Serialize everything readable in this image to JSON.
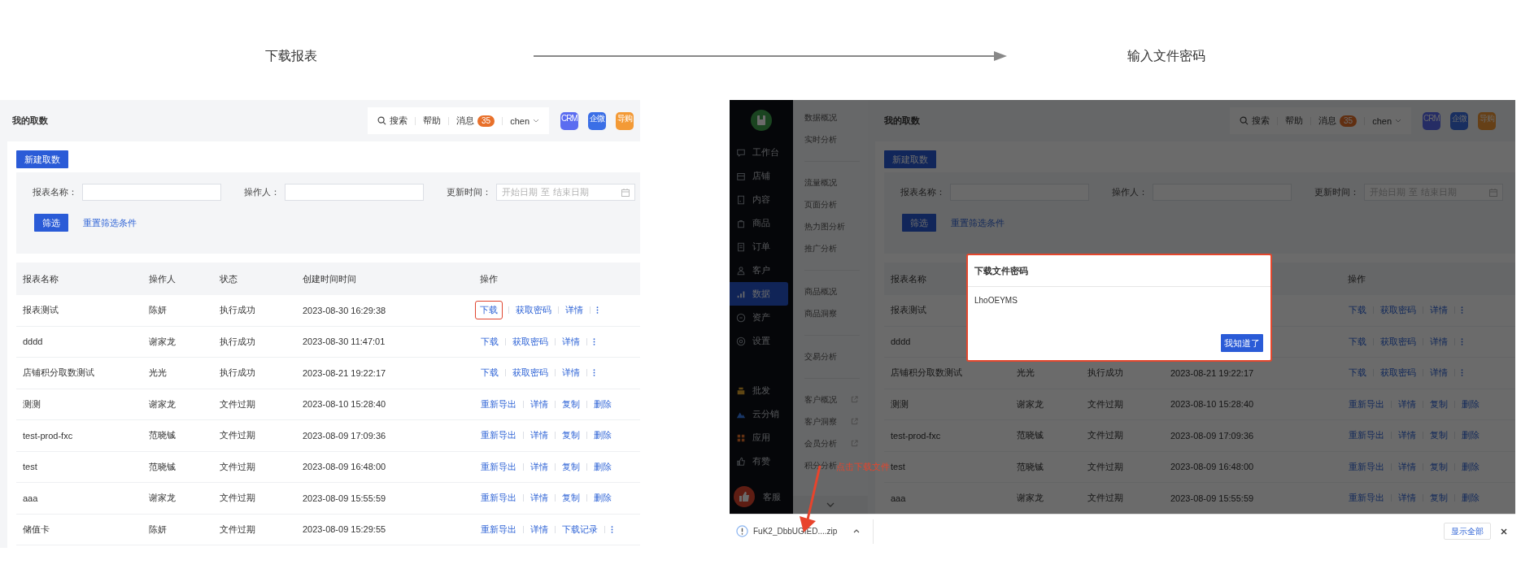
{
  "steps": [
    {
      "label": "下载报表"
    },
    {
      "label": "输入文件密码"
    }
  ],
  "left": {
    "title": "我的取数",
    "toolbar": {
      "search": "搜索",
      "help": "帮助",
      "messages": "消息",
      "badge": "35",
      "user": "chen"
    },
    "apps": [
      {
        "label": "CRM",
        "color": "#5b6cf0"
      },
      {
        "label": "企微",
        "color": "#3b6fe6"
      },
      {
        "label": "导购",
        "color": "#f39a36"
      }
    ],
    "new_button": "新建取数",
    "filters": [
      {
        "kind": "text",
        "label": "报表名称："
      },
      {
        "kind": "text",
        "label": "操作人："
      },
      {
        "kind": "date",
        "label": "更新时间：",
        "start": "开始日期",
        "sep": "至",
        "end": "结束日期"
      }
    ],
    "filter_button": "筛选",
    "reset_link": "重置筛选条件",
    "table": {
      "columns": [
        "报表名称",
        "操作人",
        "状态",
        "创建时间时间",
        "操作"
      ],
      "rows": [
        {
          "cells": [
            "报表测试",
            "陈妍",
            "执行成功",
            "2023-08-30 16:29:38"
          ],
          "actions": [
            {
              "label": "下载",
              "highlighted": true
            },
            {
              "label": "获取密码",
              "highlighted": false
            },
            {
              "label": "详情",
              "highlighted": false
            }
          ],
          "more": true
        },
        {
          "cells": [
            "dddd",
            "谢家龙",
            "执行成功",
            "2023-08-30 11:47:01"
          ],
          "actions": [
            {
              "label": "下载",
              "highlighted": false
            },
            {
              "label": "获取密码",
              "highlighted": false
            },
            {
              "label": "详情",
              "highlighted": false
            }
          ],
          "more": true
        },
        {
          "cells": [
            "店铺积分取数测试",
            "光光",
            "执行成功",
            "2023-08-21 19:22:17"
          ],
          "actions": [
            {
              "label": "下载",
              "highlighted": false
            },
            {
              "label": "获取密码",
              "highlighted": false
            },
            {
              "label": "详情",
              "highlighted": false
            }
          ],
          "more": true
        },
        {
          "cells": [
            "测测",
            "谢家龙",
            "文件过期",
            "2023-08-10 15:28:40"
          ],
          "actions": [
            {
              "label": "重新导出",
              "highlighted": false
            },
            {
              "label": "详情",
              "highlighted": false
            },
            {
              "label": "复制",
              "highlighted": false
            },
            {
              "label": "删除",
              "highlighted": false
            }
          ],
          "more": false
        },
        {
          "cells": [
            "test-prod-fxc",
            "范晓铖",
            "文件过期",
            "2023-08-09 17:09:36"
          ],
          "actions": [
            {
              "label": "重新导出",
              "highlighted": false
            },
            {
              "label": "详情",
              "highlighted": false
            },
            {
              "label": "复制",
              "highlighted": false
            },
            {
              "label": "删除",
              "highlighted": false
            }
          ],
          "more": false
        },
        {
          "cells": [
            "test",
            "范晓铖",
            "文件过期",
            "2023-08-09 16:48:00"
          ],
          "actions": [
            {
              "label": "重新导出",
              "highlighted": false
            },
            {
              "label": "详情",
              "highlighted": false
            },
            {
              "label": "复制",
              "highlighted": false
            },
            {
              "label": "删除",
              "highlighted": false
            }
          ],
          "more": false
        },
        {
          "cells": [
            "aaa",
            "谢家龙",
            "文件过期",
            "2023-08-09 15:55:59"
          ],
          "actions": [
            {
              "label": "重新导出",
              "highlighted": false
            },
            {
              "label": "详情",
              "highlighted": false
            },
            {
              "label": "复制",
              "highlighted": false
            },
            {
              "label": "删除",
              "highlighted": false
            }
          ],
          "more": false
        },
        {
          "cells": [
            "储值卡",
            "陈妍",
            "文件过期",
            "2023-08-09 15:29:55"
          ],
          "actions": [
            {
              "label": "重新导出",
              "highlighted": false
            },
            {
              "label": "详情",
              "highlighted": false
            },
            {
              "label": "下载记录",
              "highlighted": false
            }
          ],
          "more": true
        }
      ]
    }
  },
  "right": {
    "sidebar": {
      "groups": [
        [
          {
            "label": "工作台",
            "selected": false
          },
          {
            "label": "店铺",
            "selected": false
          },
          {
            "label": "内容",
            "selected": false
          },
          {
            "label": "商品",
            "selected": false
          },
          {
            "label": "订单",
            "selected": false
          },
          {
            "label": "客户",
            "selected": false
          },
          {
            "label": "数据",
            "selected": true
          },
          {
            "label": "资产",
            "selected": false
          },
          {
            "label": "设置",
            "selected": false
          }
        ],
        [
          {
            "label": "批发",
            "selected": false
          },
          {
            "label": "云分销",
            "selected": false
          },
          {
            "label": "应用",
            "selected": false
          },
          {
            "label": "有赞",
            "selected": false
          }
        ]
      ],
      "support": "客服"
    },
    "submenu": {
      "groups": [
        [
          {
            "label": "数据概况",
            "external": false
          },
          {
            "label": "实时分析",
            "external": false
          }
        ],
        [
          {
            "label": "流量概况",
            "external": false
          },
          {
            "label": "页面分析",
            "external": false
          },
          {
            "label": "热力图分析",
            "external": false
          },
          {
            "label": "推广分析",
            "external": false
          }
        ],
        [
          {
            "label": "商品概况",
            "external": false
          },
          {
            "label": "商品洞察",
            "external": false
          }
        ],
        [
          {
            "label": "交易分析",
            "external": false
          }
        ],
        [
          {
            "label": "客户概况",
            "external": true
          },
          {
            "label": "客户洞察",
            "external": true
          },
          {
            "label": "会员分析",
            "external": true
          },
          {
            "label": "积分分析",
            "external": false
          }
        ]
      ]
    },
    "page": {
      "title": "我的取数",
      "toolbar": {
        "search": "搜索",
        "help": "帮助",
        "messages": "消息",
        "badge": "35",
        "user": "chen"
      },
      "apps": [
        {
          "label": "CRM",
          "color": "#262d65"
        },
        {
          "label": "企微",
          "color": "#192f60"
        },
        {
          "label": "导购",
          "color": "#664017"
        }
      ],
      "new_button": "新建取数",
      "filters": [
        {
          "kind": "text",
          "label": "报表名称："
        },
        {
          "kind": "text",
          "label": "操作人："
        },
        {
          "kind": "date",
          "label": "更新时间：",
          "start": "开始日期",
          "sep": "至",
          "end": "结束日期"
        }
      ],
      "filter_button": "筛选",
      "reset_link": "重置筛选条件",
      "table": {
        "columns": [
          "报表名称",
          null,
          null,
          null,
          "操作"
        ],
        "rows": [
          {
            "cells": [
              "报表测试",
              null,
              null,
              null
            ],
            "actions": [
              {
                "label": "下载",
                "highlighted": false
              },
              {
                "label": "获取密码",
                "highlighted": false
              },
              {
                "label": "详情",
                "highlighted": false
              }
            ],
            "more": true
          },
          {
            "cells": [
              "dddd",
              null,
              null,
              null
            ],
            "actions": [
              {
                "label": "下载",
                "highlighted": false
              },
              {
                "label": "获取密码",
                "highlighted": false
              },
              {
                "label": "详情",
                "highlighted": false
              }
            ],
            "more": true
          },
          {
            "cells": [
              "店铺积分取数测试",
              "光光",
              "执行成功",
              "2023-08-21 19:22:17"
            ],
            "actions": [
              {
                "label": "下载",
                "highlighted": false
              },
              {
                "label": "获取密码",
                "highlighted": false
              },
              {
                "label": "详情",
                "highlighted": false
              }
            ],
            "more": true
          },
          {
            "cells": [
              "测测",
              "谢家龙",
              "文件过期",
              "2023-08-10 15:28:40"
            ],
            "actions": [
              {
                "label": "重新导出",
                "highlighted": false
              },
              {
                "label": "详情",
                "highlighted": false
              },
              {
                "label": "复制",
                "highlighted": false
              },
              {
                "label": "删除",
                "highlighted": false
              }
            ],
            "more": false
          },
          {
            "cells": [
              "test-prod-fxc",
              "范晓铖",
              "文件过期",
              "2023-08-09 17:09:36"
            ],
            "actions": [
              {
                "label": "重新导出",
                "highlighted": false
              },
              {
                "label": "详情",
                "highlighted": false
              },
              {
                "label": "复制",
                "highlighted": false
              },
              {
                "label": "删除",
                "highlighted": false
              }
            ],
            "more": false
          },
          {
            "cells": [
              "test",
              "范晓铖",
              "文件过期",
              "2023-08-09 16:48:00"
            ],
            "actions": [
              {
                "label": "重新导出",
                "highlighted": false
              },
              {
                "label": "详情",
                "highlighted": false
              },
              {
                "label": "复制",
                "highlighted": false
              },
              {
                "label": "删除",
                "highlighted": false
              }
            ],
            "more": false
          },
          {
            "cells": [
              "aaa",
              "谢家龙",
              "文件过期",
              "2023-08-09 15:55:59"
            ],
            "actions": [
              {
                "label": "重新导出",
                "highlighted": false
              },
              {
                "label": "详情",
                "highlighted": false
              },
              {
                "label": "复制",
                "highlighted": false
              },
              {
                "label": "删除",
                "highlighted": false
              }
            ],
            "more": false
          }
        ]
      }
    },
    "dialog": {
      "title": "下载文件密码",
      "password": "LhoOEYMS",
      "confirm": "我知道了"
    },
    "annotation": {
      "text": "点击下载文件"
    },
    "download_bar": {
      "file": "FuK2_DbbUGIED....zip",
      "show_all": "显示全部"
    }
  }
}
